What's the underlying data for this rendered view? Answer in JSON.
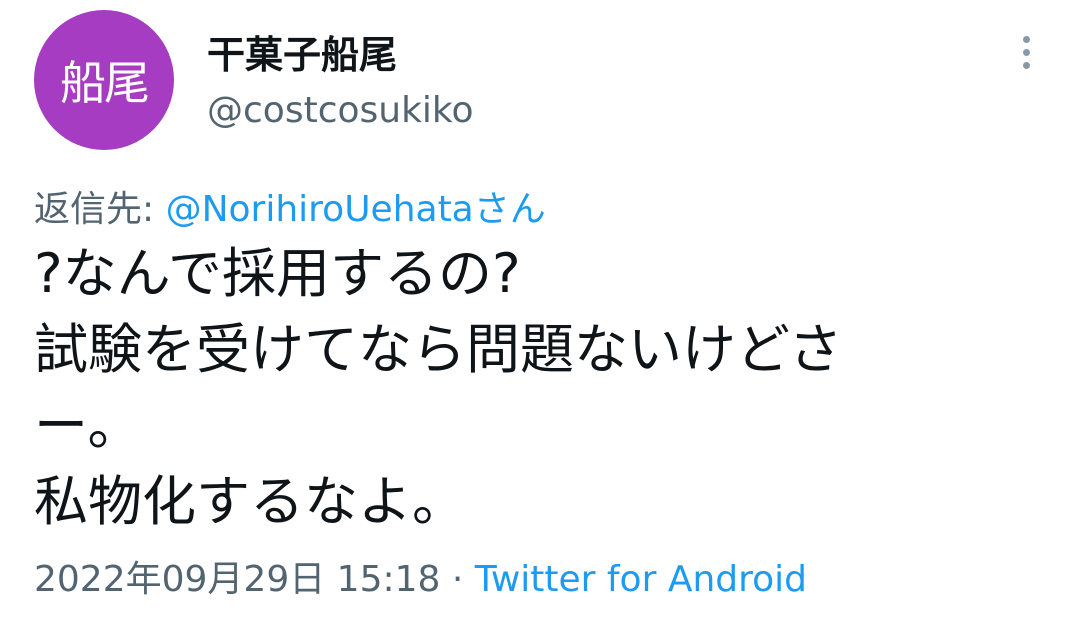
{
  "user": {
    "avatar_text": "船尾",
    "avatar_color": "#a53cc1",
    "display_name": "干菓子船尾",
    "handle": "@costcosukiko"
  },
  "reply": {
    "label": "返信先: ",
    "mention": "@NorihiroUehataさん"
  },
  "tweet": {
    "lines": [
      "?なんで採用するの?",
      "試験を受けてなら問題ないけどさ",
      "ー。",
      "私物化するなよ。"
    ]
  },
  "meta": {
    "timestamp": "2022年09月29日 15:18",
    "separator": " · ",
    "source": "Twitter for Android"
  },
  "icons": {
    "more": "more-vertical-icon"
  },
  "colors": {
    "link": "#1d9bf0",
    "secondary_text": "#536471",
    "primary_text": "#0f1419"
  }
}
